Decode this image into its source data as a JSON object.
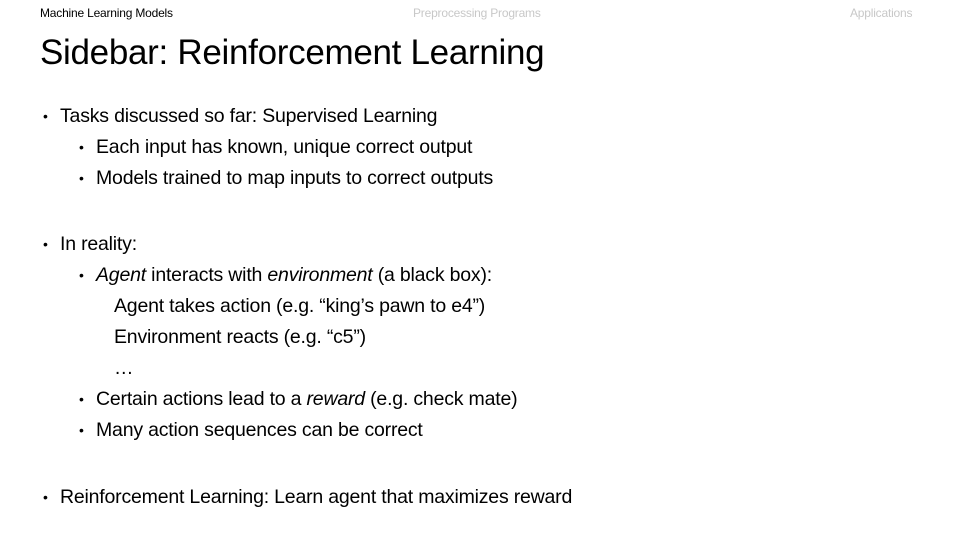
{
  "nav": {
    "items": [
      {
        "label": "Machine Learning Models",
        "active": true
      },
      {
        "label": "Preprocessing Programs",
        "active": false
      },
      {
        "label": "Applications",
        "active": false
      }
    ]
  },
  "slide": {
    "title": "Sidebar: Reinforcement Learning",
    "sections": {
      "supervised": {
        "heading": "Tasks discussed so far: Supervised Learning",
        "points": [
          "Each input has known, unique correct output",
          "Models trained to map inputs to correct outputs"
        ]
      },
      "reality": {
        "heading": "In reality:",
        "agent_point": {
          "italic_1": "Agent",
          "text_1": " interacts with ",
          "italic_2": "environment",
          "text_2": " (a black box):"
        },
        "steps": [
          "Agent takes action (e.g. “king’s pawn to e4”)",
          "Environment reacts (e.g. “c5”)",
          "…"
        ],
        "reward_point": {
          "text_1": "Certain actions lead to a ",
          "italic": "reward",
          "text_2": " (e.g. check mate)"
        },
        "sequences_point": "Many action sequences can be correct"
      },
      "conclusion": {
        "heading": "Reinforcement Learning: Learn agent that maximizes reward"
      }
    },
    "bullet_glyph": "•"
  }
}
